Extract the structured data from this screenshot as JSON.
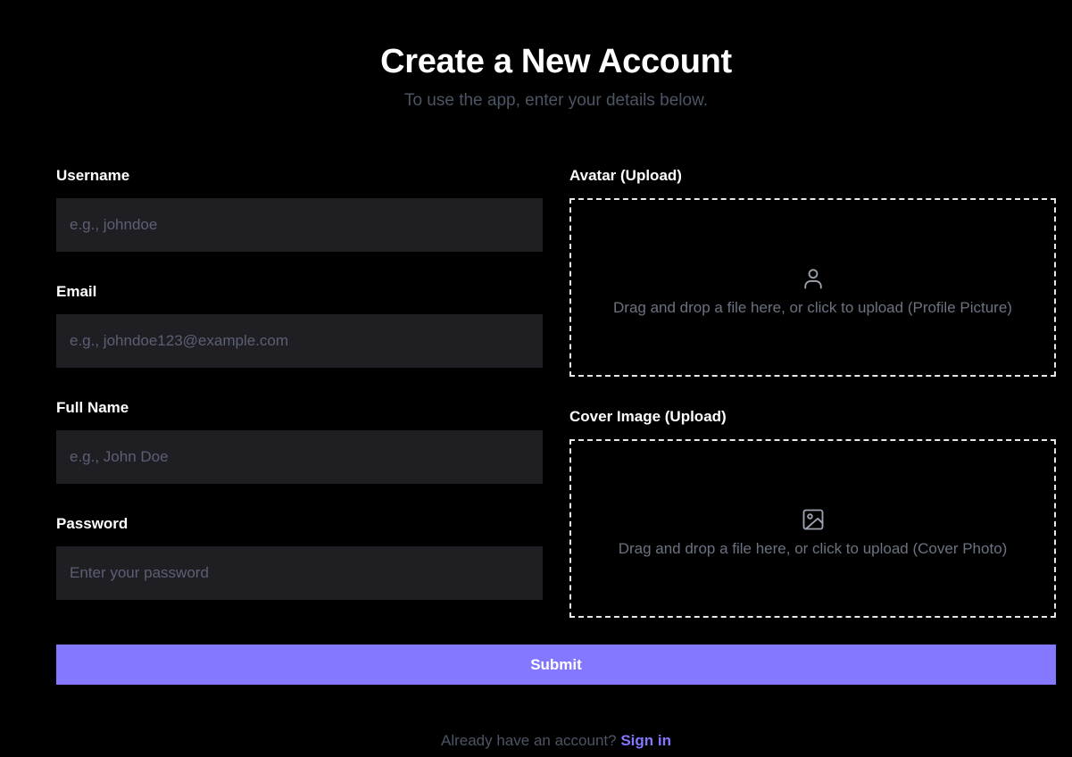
{
  "header": {
    "title": "Create a New Account",
    "subtitle": "To use the app, enter your details below."
  },
  "form": {
    "username": {
      "label": "Username",
      "placeholder": "e.g., johndoe",
      "value": ""
    },
    "email": {
      "label": "Email",
      "placeholder": "e.g., johndoe123@example.com",
      "value": ""
    },
    "full_name": {
      "label": "Full Name",
      "placeholder": "e.g., John Doe",
      "value": ""
    },
    "password": {
      "label": "Password",
      "placeholder": "Enter your password",
      "value": ""
    },
    "avatar": {
      "label": "Avatar (Upload)",
      "icon": "user-icon",
      "text": "Drag and drop a file here, or click to upload (Profile Picture)"
    },
    "cover": {
      "label": "Cover Image (Upload)",
      "icon": "image-icon",
      "text": "Drag and drop a file here, or click to upload (Cover Photo)"
    },
    "submit_label": "Submit"
  },
  "footer": {
    "text": "Already have an account?",
    "link_label": "Sign in"
  },
  "colors": {
    "background": "#000000",
    "input_background": "#1f1f23",
    "accent": "#8378ff",
    "muted_text": "#4b5563",
    "placeholder": "#5b5f73",
    "dropzone_border": "#e5e7eb"
  }
}
